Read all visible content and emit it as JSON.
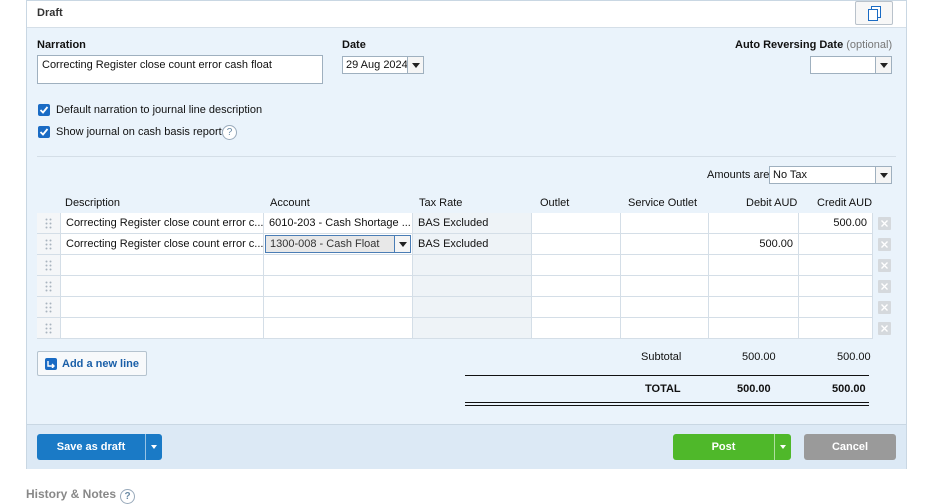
{
  "header": {
    "status_label": "Draft",
    "copy_icon": "copy-icon"
  },
  "form": {
    "narration_label": "Narration",
    "narration_value": "Correcting Register close count error cash float",
    "date_label": "Date",
    "date_value": "29 Aug 2024",
    "auto_reversing_label": "Auto Reversing Date",
    "auto_reversing_optional": "(optional)",
    "auto_reversing_value": "",
    "default_narration_label": "Default narration to journal line description",
    "default_narration_checked": true,
    "cash_basis_label": "Show journal on cash basis reports",
    "cash_basis_checked": true,
    "help_glyph": "?"
  },
  "amounts": {
    "label": "Amounts are",
    "value": "No Tax"
  },
  "table": {
    "columns": [
      "Description",
      "Account",
      "Tax Rate",
      "Outlet",
      "Service Outlet",
      "Debit AUD",
      "Credit AUD"
    ],
    "rows": [
      {
        "description": "Correcting Register close count error c...",
        "account": "6010-203 - Cash Shortage ...",
        "tax_rate": "BAS Excluded",
        "outlet": "",
        "service_outlet": "",
        "debit": "",
        "credit": "500.00"
      },
      {
        "description": "Correcting Register close count error c...",
        "account": "1300-008 - Cash Float",
        "tax_rate": "BAS Excluded",
        "outlet": "",
        "service_outlet": "",
        "debit": "500.00",
        "credit": ""
      },
      {
        "description": "",
        "account": "",
        "tax_rate": "",
        "outlet": "",
        "service_outlet": "",
        "debit": "",
        "credit": ""
      },
      {
        "description": "",
        "account": "",
        "tax_rate": "",
        "outlet": "",
        "service_outlet": "",
        "debit": "",
        "credit": ""
      },
      {
        "description": "",
        "account": "",
        "tax_rate": "",
        "outlet": "",
        "service_outlet": "",
        "debit": "",
        "credit": ""
      },
      {
        "description": "",
        "account": "",
        "tax_rate": "",
        "outlet": "",
        "service_outlet": "",
        "debit": "",
        "credit": ""
      }
    ]
  },
  "add_line_label": "Add a new line",
  "totals": {
    "subtotal_label": "Subtotal",
    "subtotal_debit": "500.00",
    "subtotal_credit": "500.00",
    "total_label": "TOTAL",
    "total_debit": "500.00",
    "total_credit": "500.00"
  },
  "footer": {
    "save_draft_label": "Save as draft",
    "post_label": "Post",
    "cancel_label": "Cancel"
  },
  "history_label": "History & Notes",
  "colors": {
    "accent_blue": "#1a7ac6",
    "post_green": "#4fb82a",
    "cancel_grey": "#9a9a9a",
    "panel_bg": "#eaf3fb"
  }
}
